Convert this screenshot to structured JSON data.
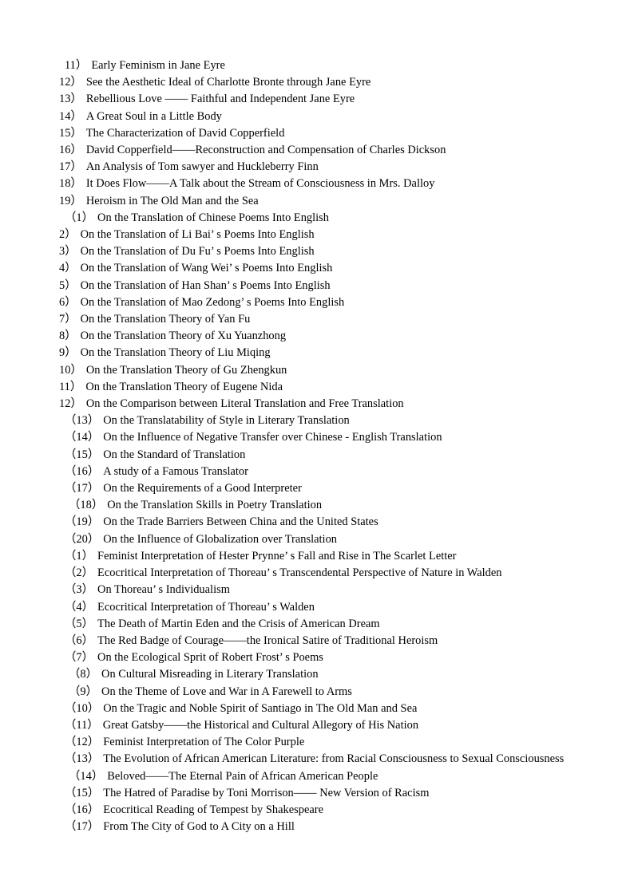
{
  "document": {
    "page_background": "#ffffff",
    "text_color": "#000000",
    "items": [
      {
        "number": "11）",
        "title": "Early Feminism in Jane Eyre",
        "indent": 1
      },
      {
        "number": "12）",
        "title": "See the Aesthetic Ideal of Charlotte Bronte through Jane Eyre",
        "indent": 0
      },
      {
        "number": "13）",
        "title": "Rebellious Love  ——  Faithful and Independent Jane Eyre",
        "indent": 0
      },
      {
        "number": "14）",
        "title": "A Great Soul in a Little Body",
        "indent": 0
      },
      {
        "number": "15）",
        "title": "The Characterization of David Copperfield",
        "indent": 0
      },
      {
        "number": "16）",
        "title": "David Copperfield——Reconstruction and Compensation of Charles Dickson",
        "indent": 0
      },
      {
        "number": "17）",
        "title": "An Analysis of Tom sawyer and Huckleberry Finn",
        "indent": 0
      },
      {
        "number": "18）",
        "title": "It Does Flow——A Talk about the Stream of Consciousness in Mrs. Dalloy",
        "indent": 0
      },
      {
        "number": "19）",
        "title": "Heroism in The Old Man and the Sea",
        "indent": 0
      },
      {
        "number": "（1）",
        "title": "On the Translation of Chinese Poems Into English",
        "indent": 1
      },
      {
        "number": "2）",
        "title": "On the Translation of Li Bai’ s Poems Into English",
        "indent": 0
      },
      {
        "number": "3）",
        "title": "On the Translation of Du Fu’ s Poems Into English",
        "indent": 0
      },
      {
        "number": "4）",
        "title": "On the Translation of Wang Wei’ s Poems Into English",
        "indent": 0
      },
      {
        "number": "5）",
        "title": "On the Translation of Han Shan’ s Poems Into English",
        "indent": 0
      },
      {
        "number": "6）",
        "title": "On the Translation of Mao Zedong’ s Poems Into English",
        "indent": 0
      },
      {
        "number": "7）",
        "title": "On the Translation Theory of Yan Fu",
        "indent": 0
      },
      {
        "number": "8）",
        "title": "On the Translation Theory of Xu Yuanzhong",
        "indent": 0
      },
      {
        "number": "9）",
        "title": "On the Translation Theory of Liu Miqing",
        "indent": 0
      },
      {
        "number": "10）",
        "title": "On the Translation Theory of Gu Zhengkun",
        "indent": 0
      },
      {
        "number": "11）",
        "title": "On the Translation Theory of Eugene Nida",
        "indent": 0
      },
      {
        "number": "12）",
        "title": "On the Comparison between Literal Translation and Free Translation",
        "indent": 0
      },
      {
        "number": "（13）",
        "title": "On the Translatability of Style in Literary Translation",
        "indent": 1
      },
      {
        "number": "（14）",
        "title": "On the Influence of Negative Transfer over Chinese - English Translation",
        "indent": 1
      },
      {
        "number": "（15）",
        "title": "On the Standard of Translation",
        "indent": 1
      },
      {
        "number": "（16）",
        "title": "A study of a Famous Translator",
        "indent": 1
      },
      {
        "number": "（17）",
        "title": "On the Requirements of a Good Interpreter",
        "indent": 1
      },
      {
        "number": "（18）",
        "title": "On the Translation Skills in Poetry Translation",
        "indent": 2
      },
      {
        "number": "（19）",
        "title": "On the Trade Barriers Between China and the United States",
        "indent": 1
      },
      {
        "number": "（20）",
        "title": "On the Influence of Globalization over Translation",
        "indent": 1
      },
      {
        "number": "（1）",
        "title": "Feminist Interpretation of Hester Prynne’ s Fall and Rise in The Scarlet Letter",
        "indent": 1
      },
      {
        "number": "（2）",
        "title": "Ecocritical Interpretation of Thoreau’ s Transcendental Perspective of Nature in Walden",
        "indent": 1
      },
      {
        "number": "（3）",
        "title": "On Thoreau’ s Individualism",
        "indent": 1
      },
      {
        "number": "（4）",
        "title": "Ecocritical Interpretation of Thoreau’ s Walden",
        "indent": 1
      },
      {
        "number": "（5）",
        "title": "The Death of Martin Eden and the Crisis of American Dream",
        "indent": 1
      },
      {
        "number": "（6）",
        "title": "The Red Badge of Courage——the Ironical Satire of Traditional Heroism",
        "indent": 1
      },
      {
        "number": "（7）",
        "title": "On the Ecological Sprit of Robert Frost’ s Poems",
        "indent": 1
      },
      {
        "number": "（8）",
        "title": "On Cultural Misreading in Literary Translation",
        "indent": 2
      },
      {
        "number": "（9）",
        "title": "On the Theme of Love and War in A Farewell to Arms",
        "indent": 2
      },
      {
        "number": "（10）",
        "title": "On the Tragic and Noble Spirit of Santiago in The Old Man and Sea",
        "indent": 1
      },
      {
        "number": "（11）",
        "title": "Great Gatsby——the Historical and Cultural Allegory of His Nation",
        "indent": 1
      },
      {
        "number": "（12）",
        "title": "Feminist Interpretation of The Color Purple",
        "indent": 1
      },
      {
        "number": "（13）",
        "title": "The Evolution of African American Literature: from Racial Consciousness to Sexual Consciousness",
        "indent": 1
      },
      {
        "number": "（14）",
        "title": "Beloved——The Eternal Pain of African American People",
        "indent": 2
      },
      {
        "number": "（15）",
        "title": "The Hatred of Paradise by Toni Morrison——  New Version of Racism",
        "indent": 1
      },
      {
        "number": "（16）",
        "title": "Ecocritical Reading of Tempest by Shakespeare",
        "indent": 1
      },
      {
        "number": "（17）",
        "title": "From The City of God to A City on a Hill",
        "indent": 1
      }
    ]
  }
}
